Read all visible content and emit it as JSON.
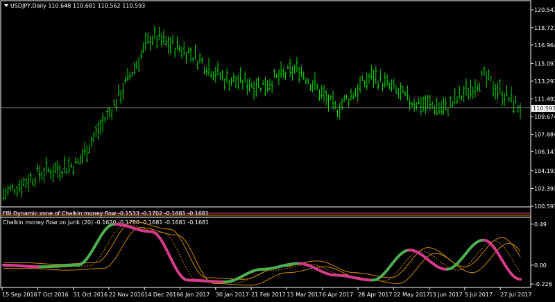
{
  "main_chart": {
    "title": "USDJPY,Daily  110.648 110.681 110.562 110.593",
    "current_price": 110.593,
    "current_price_label": "110.593",
    "price_axis": [
      "120.543",
      "118.721",
      "116.964",
      "115.091",
      "113.293",
      "111.492",
      "109.674",
      "107.884",
      "106.143",
      "104.193",
      "102.393",
      "100.593"
    ],
    "bar_color": "#00e000",
    "price_line_color": "#888888"
  },
  "dynamic_zone_panel": {
    "label": "FBI Dynamic zone of Chalkin money flow  -0.1533 -0.1702 -0.1681 -0.1681"
  },
  "indicator_panel": {
    "label": "Chalkin money flow on jurik (20) -0.1620 -0.1780 -0.1681 -0.1681 -0.1681",
    "levels": [
      "0.49",
      "0.00",
      "-0.226"
    ],
    "colors": {
      "up": "#4caf50",
      "down": "#d63a8c",
      "bands": "#d48a00"
    }
  },
  "time_axis": [
    "15 Sep 2016",
    "7 Oct 2016",
    "31 Oct 2016",
    "22 Nov 2016",
    "14 Dec 2016",
    "6 Jan 2017",
    "30 Jan 2017",
    "21 Feb 2017",
    "15 Mar 2017",
    "6 Apr 2017",
    "28 Apr 2017",
    "22 May 2017",
    "13 Jun 2017",
    "5 Jul 2017",
    "27 Jul 2017"
  ],
  "chart_data": {
    "type": "line",
    "title": "USDJPY,Daily",
    "x": [
      "15 Sep 2016",
      "7 Oct 2016",
      "31 Oct 2016",
      "22 Nov 2016",
      "14 Dec 2016",
      "6 Jan 2017",
      "30 Jan 2017",
      "21 Feb 2017",
      "15 Mar 2017",
      "6 Apr 2017",
      "28 Apr 2017",
      "22 May 2017",
      "13 Jun 2017",
      "5 Jul 2017",
      "27 Jul 2017"
    ],
    "series": [
      {
        "name": "USDJPY",
        "values": [
          101.8,
          104.0,
          104.9,
          110.9,
          117.8,
          116.3,
          113.5,
          112.9,
          114.6,
          110.4,
          113.9,
          111.3,
          110.5,
          113.7,
          110.6
        ]
      },
      {
        "name": "Chalkin money flow on jurik (20)",
        "values": [
          0.0,
          -0.02,
          0.0,
          0.49,
          0.4,
          -0.18,
          -0.2,
          -0.05,
          0.02,
          -0.12,
          -0.18,
          0.18,
          -0.05,
          0.3,
          -0.17
        ]
      }
    ],
    "ylim": [
      100.593,
      120.543
    ]
  }
}
